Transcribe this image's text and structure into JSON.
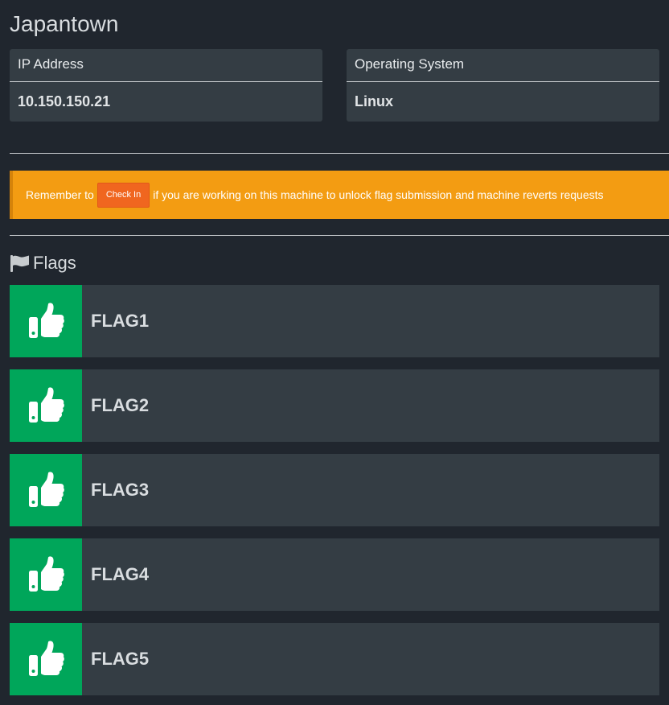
{
  "machine": {
    "name": "Japantown"
  },
  "info": {
    "ip_label": "IP Address",
    "ip_value": "10.150.150.21",
    "os_label": "Operating System",
    "os_value": "Linux"
  },
  "alert": {
    "prefix": "Remember to",
    "button_label": "Check In",
    "suffix": "if you are working on this machine to unlock flag submission and machine reverts requests",
    "color": "#f39c12",
    "button_color": "#f0661f"
  },
  "flags_section": {
    "heading": "Flags",
    "icon": "flag-icon",
    "items": [
      {
        "label": "FLAG1",
        "status_icon": "thumbs-up-icon"
      },
      {
        "label": "FLAG2",
        "status_icon": "thumbs-up-icon"
      },
      {
        "label": "FLAG3",
        "status_icon": "thumbs-up-icon"
      },
      {
        "label": "FLAG4",
        "status_icon": "thumbs-up-icon"
      },
      {
        "label": "FLAG5",
        "status_icon": "thumbs-up-icon"
      }
    ],
    "success_color": "#00a65a"
  }
}
